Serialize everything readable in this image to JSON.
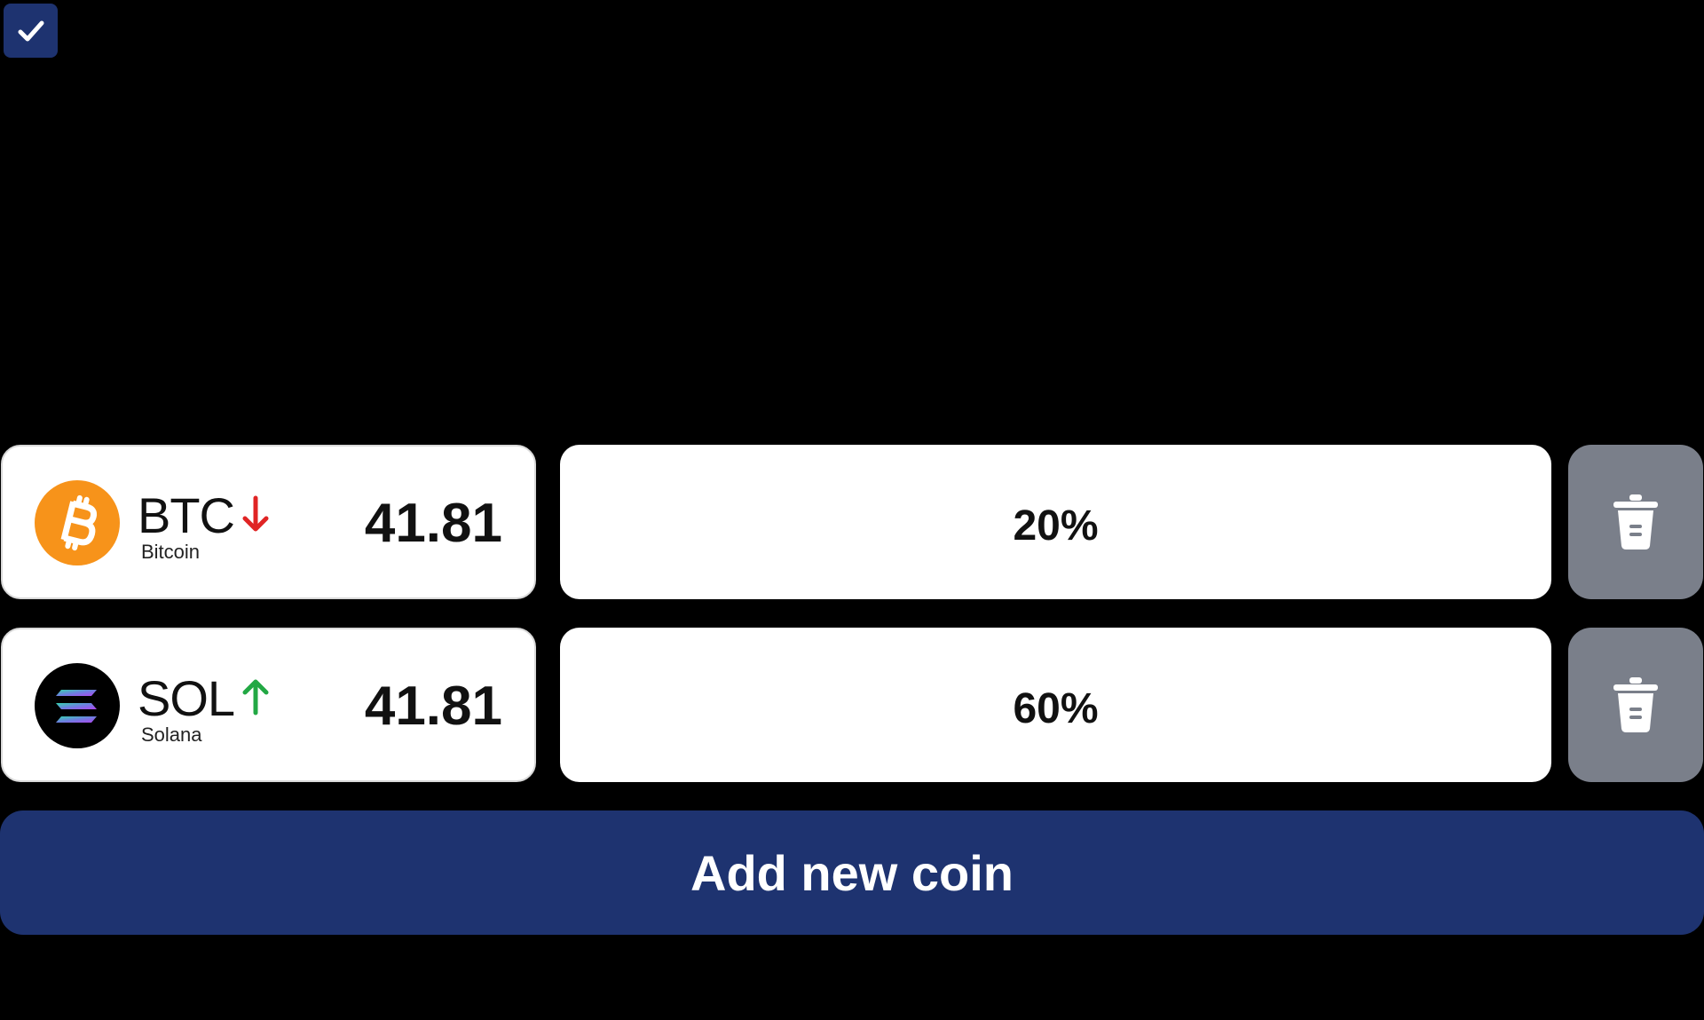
{
  "top_checkbox": {
    "checked": true,
    "icon": "checkmark-icon",
    "color": "#1e3370"
  },
  "coins": [
    {
      "symbol": "BTC",
      "name": "Bitcoin",
      "price": "41.81",
      "trend": "down",
      "trend_icon": "arrow-down-icon",
      "trend_color": "#e02424",
      "logo_icon": "bitcoin-logo-icon",
      "logo_color": "#f7931a",
      "allocation": "20%"
    },
    {
      "symbol": "SOL",
      "name": "Solana",
      "price": "41.81",
      "trend": "up",
      "trend_icon": "arrow-up-icon",
      "trend_color": "#22a844",
      "logo_icon": "solana-logo-icon",
      "logo_color": "#000000",
      "allocation": "60%"
    }
  ],
  "delete_icon": "trash-icon",
  "add_button": {
    "label": "Add new coin",
    "color": "#1e3370"
  }
}
